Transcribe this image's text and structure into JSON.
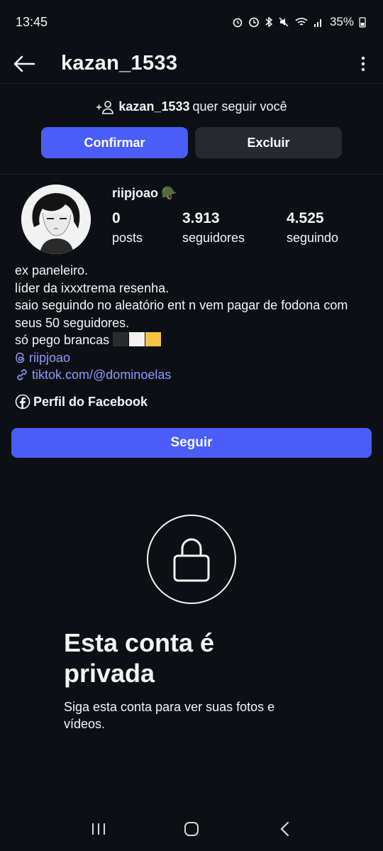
{
  "status_bar": {
    "time": "13:45",
    "battery": "35%"
  },
  "header": {
    "username": "kazan_1533",
    "back_icon": "arrow-left-icon",
    "more_icon": "more-vertical-icon"
  },
  "follow_request": {
    "username": "kazan_1533",
    "text": "quer seguir você",
    "confirm_label": "Confirmar",
    "delete_label": "Excluir",
    "confirm_color": "#4a5df9"
  },
  "profile": {
    "name": "riipjoao",
    "name_emoji": "🪖",
    "stats": [
      {
        "value": "0",
        "label": "posts"
      },
      {
        "value": "3.913",
        "label": "seguidores"
      },
      {
        "value": "4.525",
        "label": "seguindo"
      }
    ],
    "bio_lines": [
      "ex paneleiro.",
      "líder da ixxxtrema resenha.",
      "saio seguindo no aleatório ent n vem pagar de fodona com seus 50 seguidores.",
      "só pego brancas"
    ],
    "bio_squares": [
      "#2b2b2b",
      "#f2f2f2",
      "#f4c542"
    ],
    "threads_link": "riipjoao",
    "website_link": "tiktok.com/@dominoelas",
    "facebook_label": "Perfil do Facebook"
  },
  "follow_button_label": "Seguir",
  "private": {
    "title": "Esta conta é privada",
    "subtitle": "Siga esta conta para ver suas fotos e vídeos."
  }
}
